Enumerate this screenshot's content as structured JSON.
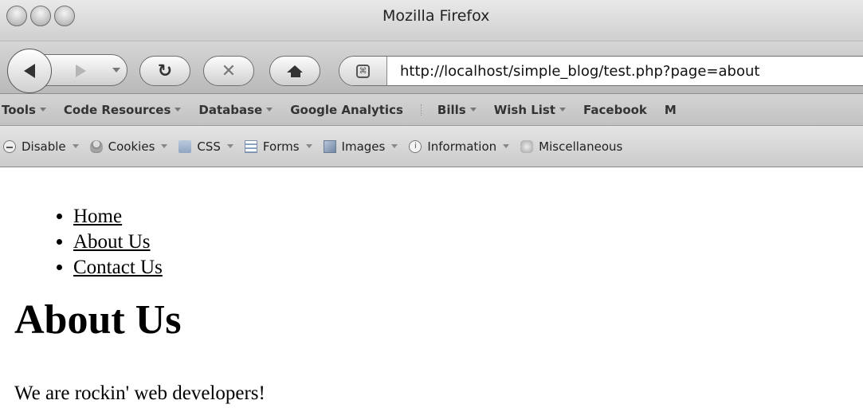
{
  "window": {
    "title": "Mozilla Firefox"
  },
  "navbar": {
    "url": "http://localhost/simple_blog/test.php?page=about"
  },
  "bookmarks": [
    {
      "label": "Tools",
      "dropdown": true
    },
    {
      "label": "Code Resources",
      "dropdown": true
    },
    {
      "label": "Database",
      "dropdown": true
    },
    {
      "label": "Google Analytics",
      "dropdown": false
    },
    {
      "label": "Bills",
      "dropdown": true
    },
    {
      "label": "Wish List",
      "dropdown": true
    },
    {
      "label": "Facebook",
      "dropdown": false
    },
    {
      "label": "M",
      "dropdown": false
    }
  ],
  "devtoolbar": [
    {
      "label": "Disable",
      "icon": "disable-icon"
    },
    {
      "label": "Cookies",
      "icon": "cookies-icon"
    },
    {
      "label": "CSS",
      "icon": "css-icon"
    },
    {
      "label": "Forms",
      "icon": "forms-icon"
    },
    {
      "label": "Images",
      "icon": "images-icon"
    },
    {
      "label": "Information",
      "icon": "information-icon"
    },
    {
      "label": "Miscellaneous",
      "icon": "miscellaneous-icon"
    }
  ],
  "page": {
    "nav": [
      "Home",
      "About Us",
      "Contact Us"
    ],
    "heading": "About Us",
    "body": "We are rockin' web developers!"
  }
}
